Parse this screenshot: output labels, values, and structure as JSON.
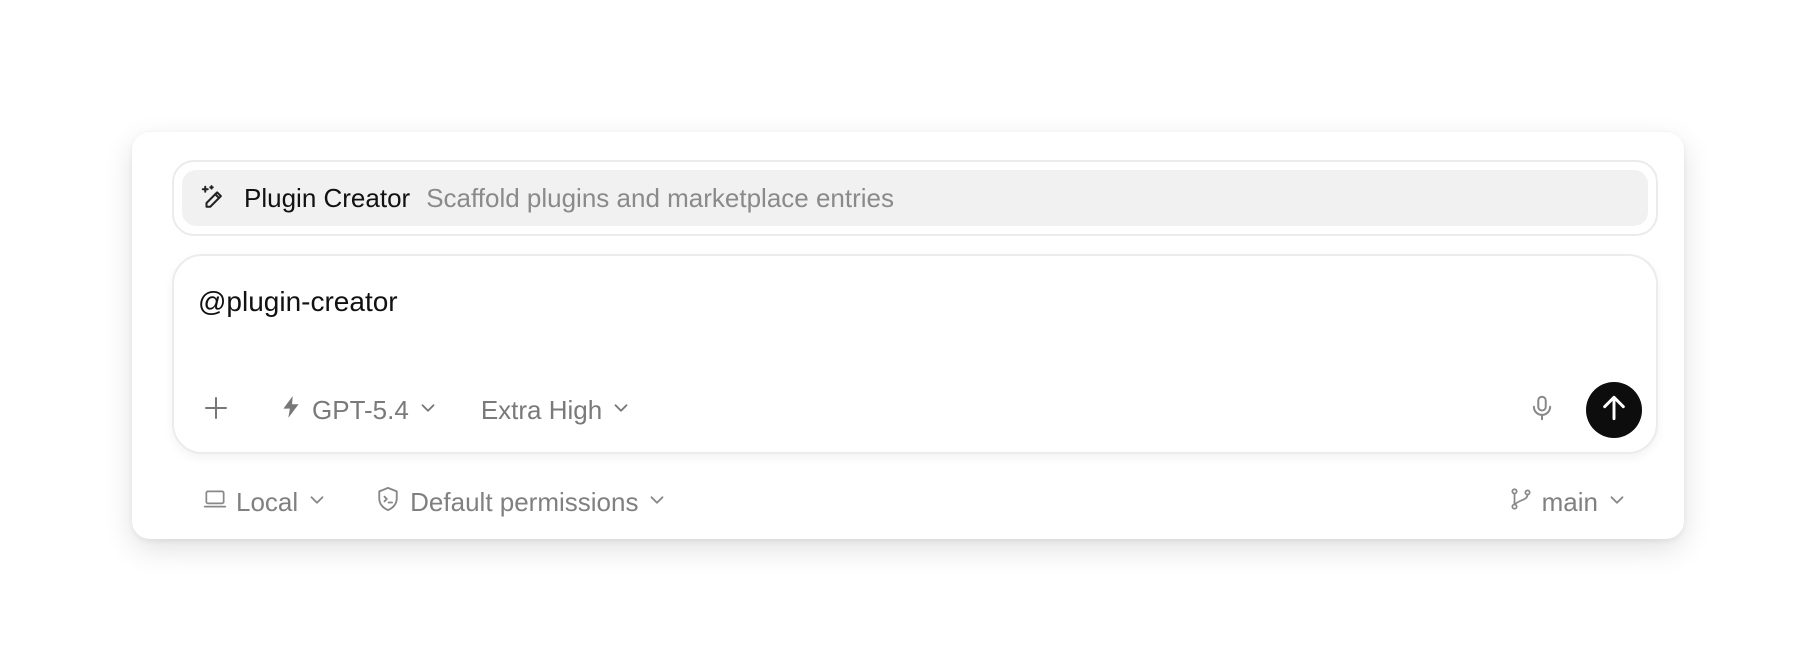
{
  "suggestion": {
    "icon": "wand-pencil-icon",
    "title": "Plugin Creator",
    "description": "Scaffold plugins and marketplace entries"
  },
  "composer": {
    "text": "@plugin-creator",
    "model_label": "GPT-5.4",
    "effort_label": "Extra High",
    "send_icon": "arrow-up-icon",
    "mic_icon": "microphone-icon",
    "add_icon": "plus-icon"
  },
  "footer": {
    "environment_label": "Local",
    "permissions_label": "Default permissions",
    "branch_label": "main"
  },
  "colors": {
    "send_button": "#0d0d0d",
    "muted_text": "#7a7a7a",
    "suggestion_bg": "#f1f1f1"
  }
}
